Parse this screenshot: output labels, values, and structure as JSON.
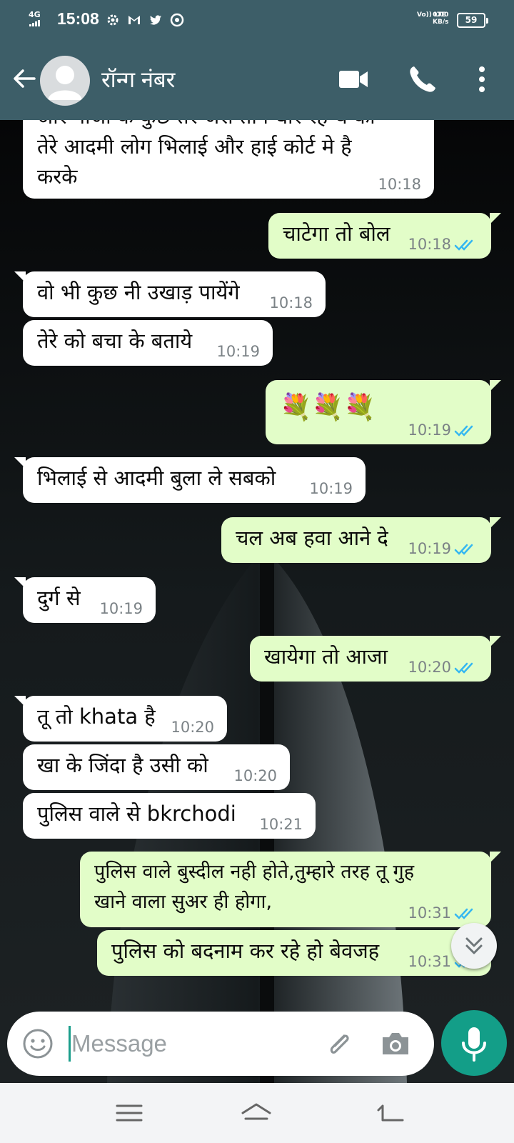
{
  "status_bar": {
    "network": "4G",
    "time": "15:08",
    "volte": "Vo)) LTE",
    "speed_value": "0.00",
    "speed_unit": "KB/s",
    "battery": "59",
    "icons": [
      "settings-icon",
      "gmail-icon",
      "twitter-icon",
      "chrome-icon"
    ]
  },
  "header": {
    "contact_name": "रॉन्ग नंबर",
    "icons": [
      "back-arrow-icon",
      "avatar-icon",
      "video-call-icon",
      "phone-icon",
      "more-vert-icon"
    ]
  },
  "messages": [
    {
      "dir": "in",
      "lines": [
        "और गाजा के कुछ तर जरा तान धार रह थ का",
        "तेरे आदमी लोग भिलाई और हाई कोर्ट मे है",
        "करके"
      ],
      "time": "10:18"
    },
    {
      "dir": "out",
      "lines": [
        "चाटेगा तो बोल"
      ],
      "time": "10:18",
      "status": "read"
    },
    {
      "dir": "in",
      "lines": [
        "वो भी कुछ नी उखाड़ पायेंगे"
      ],
      "time": "10:18"
    },
    {
      "dir": "in",
      "lines": [
        "तेरे को बचा के बताये"
      ],
      "time": "10:19"
    },
    {
      "dir": "out",
      "lines": [
        "💐💐💐"
      ],
      "time": "10:19",
      "status": "read"
    },
    {
      "dir": "in",
      "lines": [
        "भिलाई से आदमी बुला ले सबको"
      ],
      "time": "10:19"
    },
    {
      "dir": "out",
      "lines": [
        "चल अब हवा आने दे"
      ],
      "time": "10:19",
      "status": "read"
    },
    {
      "dir": "in",
      "lines": [
        "दुर्ग से"
      ],
      "time": "10:19"
    },
    {
      "dir": "out",
      "lines": [
        "खायेगा तो आजा"
      ],
      "time": "10:20",
      "status": "read"
    },
    {
      "dir": "in",
      "lines": [
        "तू तो khata है"
      ],
      "time": "10:20"
    },
    {
      "dir": "in",
      "lines": [
        "खा के जिंदा है उसी को"
      ],
      "time": "10:20"
    },
    {
      "dir": "in",
      "lines": [
        "पुलिस वाले से bkrchodi"
      ],
      "time": "10:21"
    },
    {
      "dir": "out",
      "lines": [
        "पुलिस वाले बुस्दील नही होते,तुम्हारे तरह तू गुह",
        "खाने वाला सुअर ही होगा,"
      ],
      "time": "10:31",
      "status": "read"
    },
    {
      "dir": "out",
      "lines": [
        "पुलिस को बदनाम कर रहे हो बेवजह"
      ],
      "time": "10:31",
      "status": "read"
    }
  ],
  "composer": {
    "placeholder": "Message",
    "value": ""
  },
  "colors": {
    "header": "#3d5e68",
    "incoming_bubble": "#ffffff",
    "outgoing_bubble": "#e2fdc8",
    "read_ticks": "#34b7f1",
    "mic_button": "#139e88"
  },
  "nav_icons": [
    "recents-menu-icon",
    "home-icon",
    "back-nav-icon"
  ]
}
